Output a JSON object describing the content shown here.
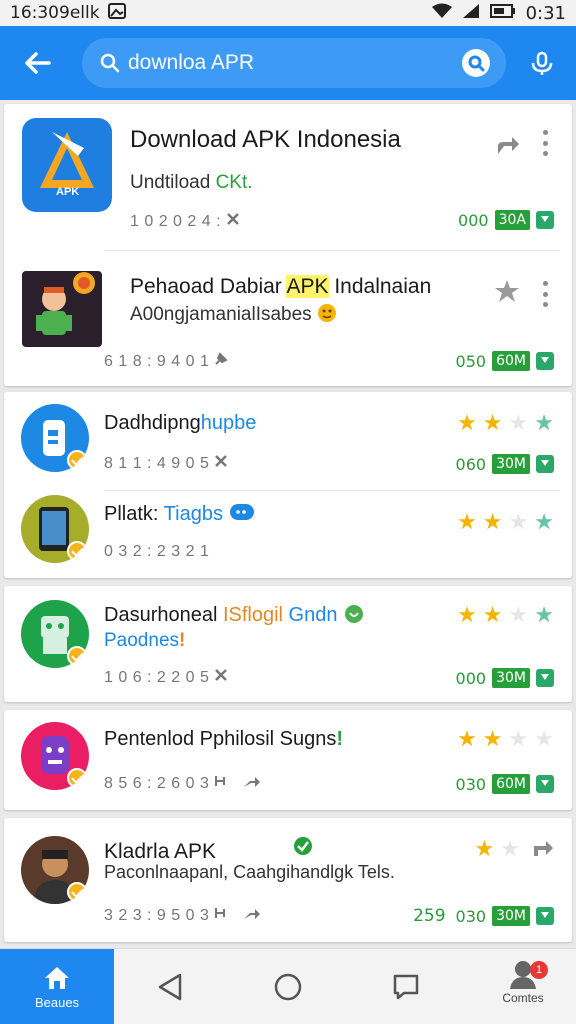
{
  "status_bar": {
    "time": "16:30",
    "suffix": "9ellk",
    "clock": "0:31"
  },
  "search": {
    "query": "downloa APR"
  },
  "apps": [
    {
      "title": "Download APK Indonesia",
      "subtitle_a": "Undtiload ",
      "subtitle_b": "CKt.",
      "meta": "1 0 2 0 2 4 : ",
      "right_num": "000",
      "right_badge": "30A",
      "icon_text": "APK"
    },
    {
      "title_a": "Pehaoad Dabiar ",
      "title_b": "APK",
      "title_c": " Indalnaian",
      "subtitle": "A00ngjamanialIsabes",
      "meta": "6 1 8 : 9 4 0 1",
      "right_num": "050",
      "right_badge": "60M"
    },
    {
      "title_a": "Dadhdipng",
      "title_b": "hupbe",
      "meta": "8 1 1 : 4 9 0 5",
      "right_num": "060",
      "right_badge": "30M",
      "rating": 2
    },
    {
      "title_a": "Pllatk: ",
      "title_b": "Tiagbs",
      "meta": "0 3 2 : 2 3 2 1",
      "rating": 2
    },
    {
      "title_a": "Dasurhoneal ",
      "title_b": "ISflogil",
      "title_c": " Gndn",
      "subtitle": "Paodnes",
      "meta": "1 0 6 : 2 2 0 5",
      "right_num": "000",
      "right_badge": "30M",
      "rating": 2
    },
    {
      "title": "Pentenlod Pphilosil Sugns",
      "meta": "8 5 6 : 2 6 0 3",
      "right_num": "030",
      "right_badge": "60M",
      "rating": 2
    },
    {
      "title": "Kladrla APK",
      "subtitle": "Paconlnaapanl, Caahgihandlgk Tels.",
      "meta": "3 2 3 : 9 5 0 3",
      "right_num_a": "259",
      "right_num": "030",
      "right_badge": "30M",
      "rating": 1
    }
  ],
  "bottom_nav": {
    "home_label": "Beaues",
    "account_label": "Comtes",
    "badge": "1"
  },
  "colors": {
    "primary": "#1e88f0",
    "green": "#27a03b",
    "star": "#f5b400"
  }
}
